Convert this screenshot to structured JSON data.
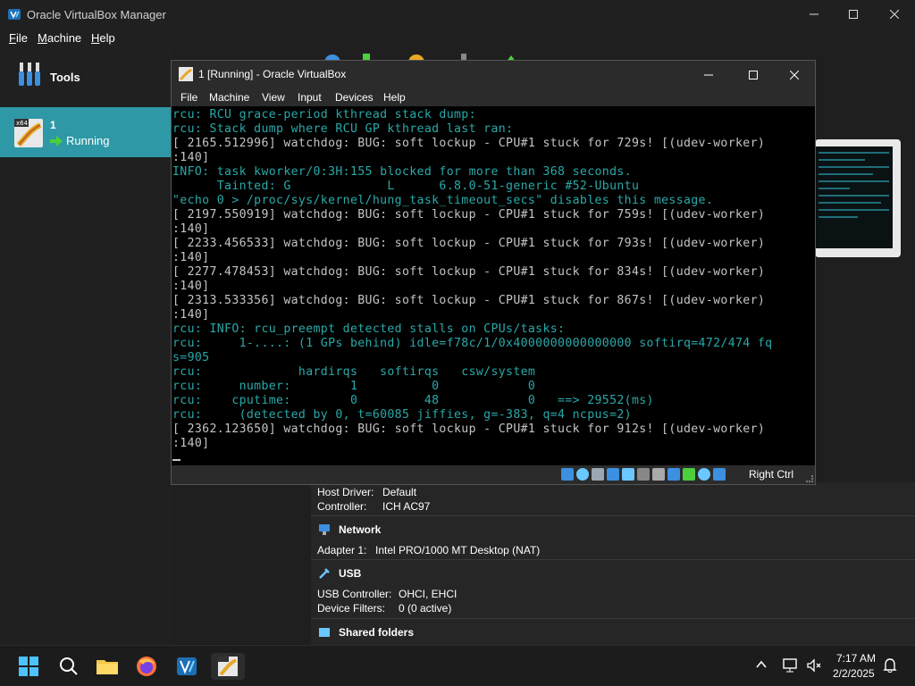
{
  "manager": {
    "title": "Oracle VirtualBox Manager",
    "menu": [
      {
        "label": "File",
        "accel": "F",
        "rest": "ile"
      },
      {
        "label": "Machine",
        "accel": "M",
        "rest": "achine"
      },
      {
        "label": "Help",
        "accel": "H",
        "rest": "elp"
      }
    ],
    "tools_label": "Tools",
    "vm_item": {
      "name": "1",
      "state": "Running"
    },
    "details": {
      "audio": {
        "host_driver_key": "Host Driver:",
        "host_driver_val": "Default",
        "controller_key": "Controller:",
        "controller_val": "ICH AC97"
      },
      "network": {
        "title": "Network",
        "adapter_key": "Adapter 1:",
        "adapter_val": "Intel PRO/1000 MT Desktop (NAT)"
      },
      "usb": {
        "title": "USB",
        "controller_key": "USB Controller:",
        "controller_val": "OHCI, EHCI",
        "filters_key": "Device Filters:",
        "filters_val": "0 (0 active)"
      },
      "shared": {
        "title": "Shared folders"
      }
    }
  },
  "vm_window": {
    "title": "1 [Running] - Oracle VirtualBox",
    "menu": [
      "File",
      "Machine",
      "View",
      "Input",
      "Devices",
      "Help"
    ],
    "host_key": "Right Ctrl",
    "console_lines": [
      {
        "t": "rcu: RCU grace-period kthread stack dump:",
        "c": "c"
      },
      {
        "t": "rcu: Stack dump where RCU GP kthread last ran:",
        "c": "c"
      },
      {
        "t": "[ 2165.512996] watchdog: BUG: soft lockup - CPU#1 stuck for 729s! [(udev-worker)",
        "c": "w"
      },
      {
        "t": ":140]",
        "c": "w"
      },
      {
        "t": "INFO: task kworker/0:3H:155 blocked for more than 368 seconds.",
        "c": "c"
      },
      {
        "t": "      Tainted: G             L      6.8.0-51-generic #52-Ubuntu",
        "c": "c"
      },
      {
        "t": "\"echo 0 > /proc/sys/kernel/hung_task_timeout_secs\" disables this message.",
        "c": "c"
      },
      {
        "t": "[ 2197.550919] watchdog: BUG: soft lockup - CPU#1 stuck for 759s! [(udev-worker)",
        "c": "w"
      },
      {
        "t": ":140]",
        "c": "w"
      },
      {
        "t": "[ 2233.456533] watchdog: BUG: soft lockup - CPU#1 stuck for 793s! [(udev-worker)",
        "c": "w"
      },
      {
        "t": ":140]",
        "c": "w"
      },
      {
        "t": "[ 2277.478453] watchdog: BUG: soft lockup - CPU#1 stuck for 834s! [(udev-worker)",
        "c": "w"
      },
      {
        "t": ":140]",
        "c": "w"
      },
      {
        "t": "[ 2313.533356] watchdog: BUG: soft lockup - CPU#1 stuck for 867s! [(udev-worker)",
        "c": "w"
      },
      {
        "t": ":140]",
        "c": "w"
      },
      {
        "t": "rcu: INFO: rcu_preempt detected stalls on CPUs/tasks:",
        "c": "c"
      },
      {
        "t": "rcu:     1-....: (1 GPs behind) idle=f78c/1/0x4000000000000000 softirq=472/474 fq",
        "c": "c"
      },
      {
        "t": "s=905",
        "c": "c"
      },
      {
        "t": "rcu:             hardirqs   softirqs   csw/system",
        "c": "c"
      },
      {
        "t": "rcu:     number:        1          0            0",
        "c": "c"
      },
      {
        "t": "rcu:    cputime:        0         48            0   ==> 29552(ms)",
        "c": "c"
      },
      {
        "t": "rcu:     (detected by 0, t=60085 jiffies, g=-383, q=4 ncpus=2)",
        "c": "c"
      },
      {
        "t": "[ 2362.123650] watchdog: BUG: soft lockup - CPU#1 stuck for 912s! [(udev-worker)",
        "c": "w"
      },
      {
        "t": ":140]",
        "c": "w"
      }
    ]
  },
  "taskbar": {
    "time": "7:17 AM",
    "date": "2/2/2025"
  },
  "colors": {
    "accent": "#2e98a6",
    "console_cyan": "#2aa8a8",
    "console_white": "#c4c4c4"
  }
}
